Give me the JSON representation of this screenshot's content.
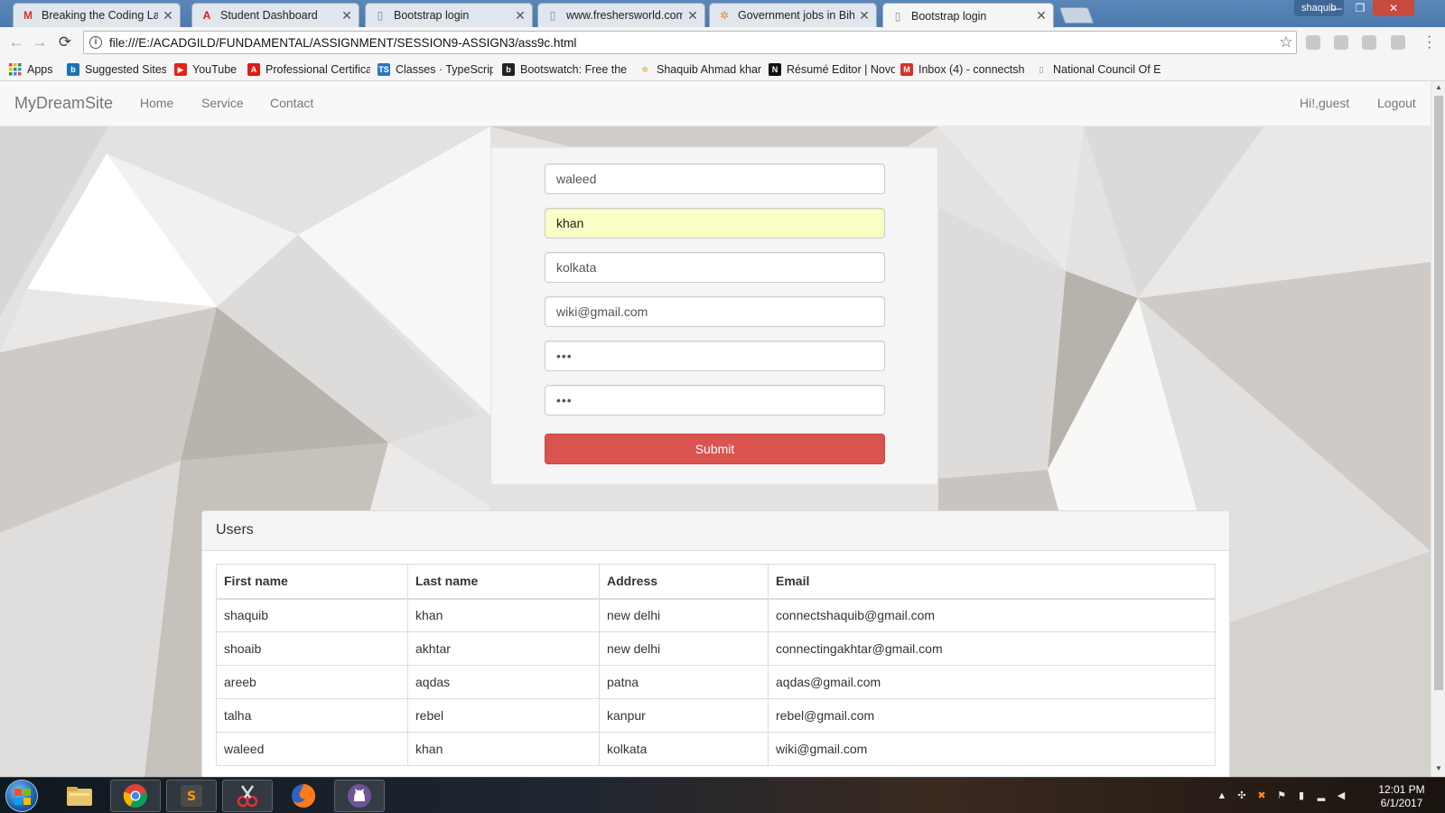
{
  "browser": {
    "tabs": [
      {
        "title": "Breaking the Coding Lan",
        "icon": "gmail-icon",
        "color": "#d93025",
        "glyph": "M"
      },
      {
        "title": "Student Dashboard",
        "icon": "angular-icon",
        "color": "#dd1b16",
        "glyph": "A"
      },
      {
        "title": "Bootstrap login",
        "icon": "page-icon",
        "color": "#888888",
        "glyph": "▯"
      },
      {
        "title": "www.freshersworld.com",
        "icon": "page-icon",
        "color": "#888888",
        "glyph": "▯"
      },
      {
        "title": "Government jobs in Biha",
        "icon": "flower-icon",
        "color": "#e08a3a",
        "glyph": "✲"
      },
      {
        "title": "Bootstrap login",
        "icon": "page-icon",
        "color": "#888888",
        "glyph": "▯",
        "active": true
      }
    ],
    "profile_name": "shaquib",
    "url": "file:///E:/ACADGILD/FUNDAMENTAL/ASSIGNMENT/SESSION9-ASSIGN3/ass9c.html",
    "bookmarks": [
      {
        "label": "Apps",
        "icon": "apps-grid-icon",
        "color": "#e04a3f"
      },
      {
        "label": "Suggested Sites",
        "icon": "bing-icon",
        "color": "#1a73b8",
        "glyph": "b"
      },
      {
        "label": "YouTube",
        "icon": "youtube-icon",
        "color": "#e62117",
        "glyph": "▶"
      },
      {
        "label": "Professional Certifica",
        "icon": "angular-icon",
        "color": "#dd1b16",
        "glyph": "A"
      },
      {
        "label": "Classes · TypeScript",
        "icon": "typescript-icon",
        "color": "#2f74c0",
        "glyph": "TS"
      },
      {
        "label": "Bootswatch: Free the",
        "icon": "bootswatch-icon",
        "color": "#222222",
        "glyph": "b"
      },
      {
        "label": "Shaquib Ahmad khan",
        "icon": "flower-icon",
        "color": "#d9a441",
        "glyph": "✲"
      },
      {
        "label": "Résumé Editor | Novo",
        "icon": "novo-icon",
        "color": "#111111",
        "glyph": "N"
      },
      {
        "label": "Inbox (4) - connectsh",
        "icon": "gmail-icon",
        "color": "#d93025",
        "glyph": "M"
      },
      {
        "label": "National Council Of E",
        "icon": "page-icon",
        "color": "#888888",
        "glyph": "▯"
      }
    ]
  },
  "site": {
    "brand": "MyDreamSite",
    "nav": [
      "Home",
      "Service",
      "Contact"
    ],
    "greeting": "Hi!,guest",
    "logout": "Logout"
  },
  "form": {
    "first_name": "waleed",
    "last_name": "khan",
    "address": "kolkata",
    "email": "wiki@gmail.com",
    "password": "•••",
    "confirm_password": "•••",
    "submit_label": "Submit",
    "submit_color": "#d9534f",
    "autofill_color": "#fafdc4"
  },
  "users": {
    "title": "Users",
    "columns": [
      "First name",
      "Last name",
      "Address",
      "Email"
    ],
    "rows": [
      [
        "shaquib",
        "khan",
        "new delhi",
        "connectshaquib@gmail.com"
      ],
      [
        "shoaib",
        "akhtar",
        "new delhi",
        "connectingakhtar@gmail.com"
      ],
      [
        "areeb",
        "aqdas",
        "patna",
        "aqdas@gmail.com"
      ],
      [
        "talha",
        "rebel",
        "kanpur",
        "rebel@gmail.com"
      ],
      [
        "waleed",
        "khan",
        "kolkata",
        "wiki@gmail.com"
      ]
    ]
  },
  "taskbar": {
    "apps": [
      "file-explorer-icon",
      "chrome-icon",
      "sublime-text-icon",
      "snipping-tool-icon",
      "firefox-icon",
      "github-icon"
    ],
    "time": "12:01 PM",
    "date": "6/1/2017"
  }
}
